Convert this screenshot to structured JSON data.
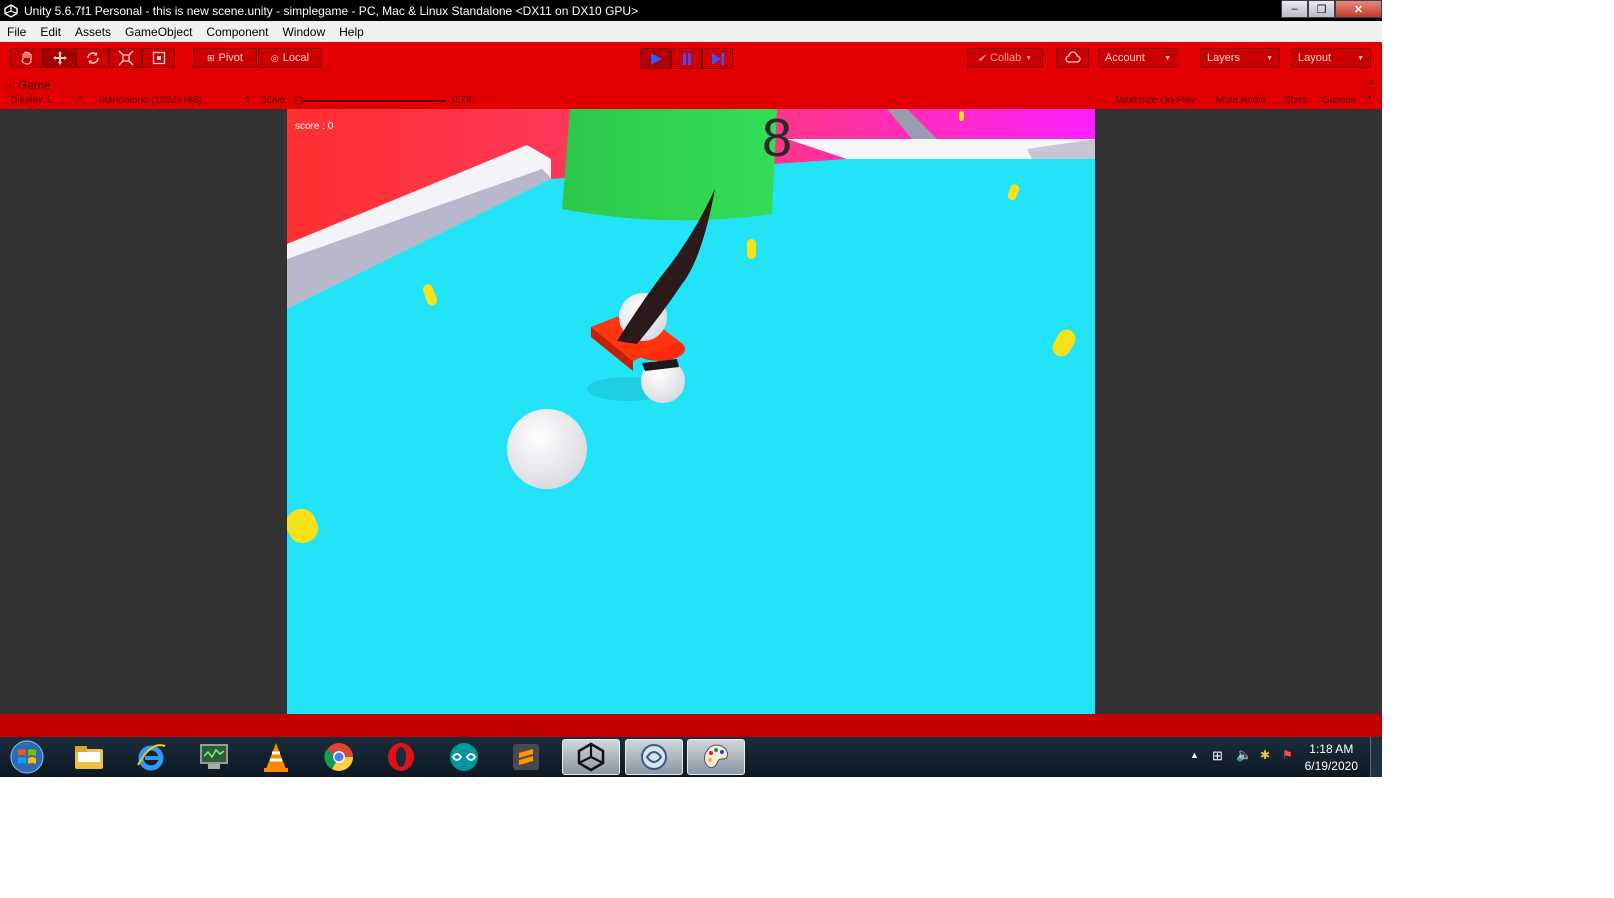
{
  "window": {
    "title": "Unity 5.6.7f1 Personal - this is new scene.unity - simplegame - PC, Mac & Linux Standalone <DX11 on DX10 GPU>",
    "controls": {
      "minimize": "–",
      "maximize": "❐",
      "close": "✕"
    }
  },
  "menu": {
    "items": [
      "File",
      "Edit",
      "Assets",
      "GameObject",
      "Component",
      "Window",
      "Help"
    ]
  },
  "toolbar": {
    "pivot_label": "Pivot",
    "local_label": "Local",
    "collab_label": "Collab",
    "account_label": "Account",
    "layers_label": "Layers",
    "layout_label": "Layout"
  },
  "game_view": {
    "tab_label": "Game",
    "display_label": "Display 1",
    "resolution_label": "Standalone (1024x768)",
    "scale_label": "Scale",
    "scale_value": "0.78",
    "maximize_label": "Maximize On Play",
    "mute_label": "Mute Audio",
    "stats_label": "Stats",
    "gizmos_label": "Gizmos",
    "score_text": "score : 0",
    "timer_text": "8"
  },
  "taskbar": {
    "apps": [
      "windows-explorer",
      "internet-explorer",
      "system-monitor",
      "vlc",
      "chrome",
      "opera",
      "arduino",
      "sublime-text",
      "unity",
      "monodevelop",
      "paint"
    ],
    "time": "1:18 AM",
    "date": "6/19/2020"
  },
  "colors": {
    "theme_red": "#e30000",
    "floor": "#22e4f6",
    "editor_bg": "#323232"
  }
}
